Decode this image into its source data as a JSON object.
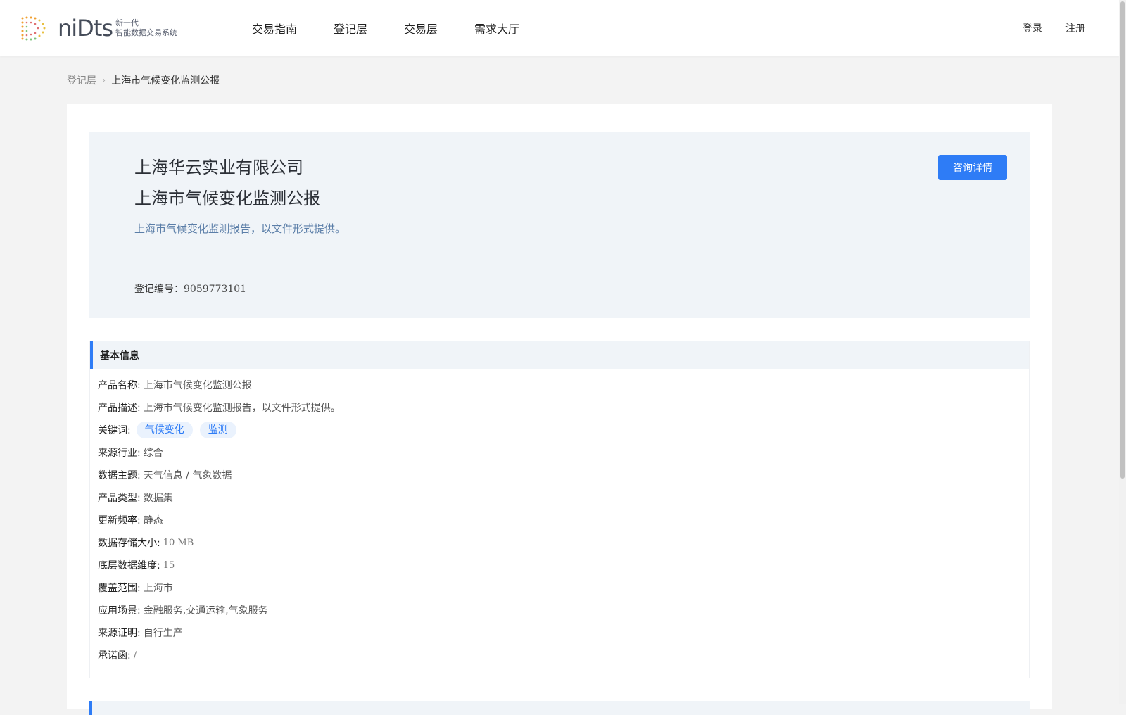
{
  "header": {
    "logo_text": "niDts",
    "logo_sub_line1": "新一代",
    "logo_sub_line2": "智能数据交易系统",
    "nav": [
      "交易指南",
      "登记层",
      "交易层",
      "需求大厅"
    ],
    "login": "登录",
    "register": "注册"
  },
  "breadcrumb": {
    "parent": "登记层",
    "current": "上海市气候变化监测公报"
  },
  "hero": {
    "company": "上海华云实业有限公司",
    "title": "上海市气候变化监测公报",
    "description": "上海市气候变化监测报告，以文件形式提供。",
    "reg_label": "登记编号：",
    "reg_number": "9059773101",
    "consult_button": "咨询详情"
  },
  "basic_info": {
    "heading": "基本信息",
    "product_name": {
      "label": "产品名称:",
      "value": "上海市气候变化监测公报"
    },
    "product_desc": {
      "label": "产品描述:",
      "value": "上海市气候变化监测报告，以文件形式提供。"
    },
    "keywords": {
      "label": "关键词:",
      "tags": [
        "气候变化",
        "监测"
      ]
    },
    "industry": {
      "label": "来源行业:",
      "value": "综合"
    },
    "topic": {
      "label": "数据主题:",
      "value": "天气信息 / 气象数据"
    },
    "type": {
      "label": "产品类型:",
      "value": "数据集"
    },
    "frequency": {
      "label": "更新频率:",
      "value": "静态"
    },
    "storage": {
      "label": "数据存储大小:",
      "value": "10 MB"
    },
    "dimension": {
      "label": "底层数据维度:",
      "value": "15"
    },
    "coverage": {
      "label": "覆盖范围:",
      "value": "上海市"
    },
    "scenarios": {
      "label": "应用场景:",
      "value": "金融服务,交通运输,气象服务"
    },
    "source_proof": {
      "label": "来源证明:",
      "value": "自行生产"
    },
    "commitment": {
      "label": "承诺函:",
      "value": "/"
    }
  },
  "colors": {
    "accent": "#2e7cf6",
    "hero_bg": "#f0f4f8",
    "page_bg": "#f3f3f3"
  }
}
